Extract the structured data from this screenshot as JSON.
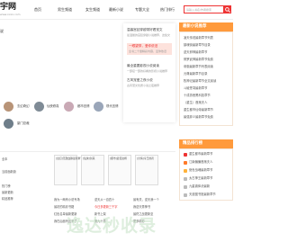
{
  "header": {
    "logo": "宇网",
    "logo_sub": "www.xxxx.com",
    "nav": [
      "首页",
      "男生频道",
      "女生频道",
      "最新小说",
      "专题大全",
      "热门排行"
    ],
    "search_placeholder": "请输入书名/作者搜索"
  },
  "main": {
    "section_label": "说",
    "thumbs_row1": [
      "玄幻奇幻",
      "仙侠修真",
      "都市言情",
      "现代言情",
      "古代言情"
    ],
    "thumbs_row2": [
      "豪门总裁"
    ]
  },
  "dropdown": {
    "items": [
      {
        "title": "温馨宫廷穿越带好看宠文",
        "sub": "最温馨的宫廷穿越小说推荐，这些文"
      },
      {
        "title": "一眼望穿，爱你依旧",
        "sub": "全书二十章精彩内容，爱你依旧"
      },
      {
        "title": "最全重要影视小说阅读",
        "sub": "一部接一部的好看的影视小说推荐"
      },
      {
        "title": "古风宠爱之夜小说",
        "sub": "古风宠文优质小说之夜推荐"
      }
    ]
  },
  "right_panel": {
    "title1": "最新小说推荐",
    "rows1": [
      "凌天传说最新章节列表",
      "镇魂街最新章节目录",
      "逆天邪神最新章节",
      "修罗武神最新章节免费",
      "帝霸最新章节列表阅读",
      "元尊最新章节目录",
      "牧神记最新章节全文阅读",
      "斗破苍穹最新章节",
      "十成熟悉黑科技章节",
      "（重生）首席夫人",
      "重生都市仙帝最新章节",
      "最强弃少最新章节免费"
    ],
    "title2": "精品排行榜",
    "rows2": [
      "重生都市最新章节",
      "江南偏偏首席夫人",
      "绝世战魂最新章节",
      "太古神王最新章节",
      "九星霸体诀最新",
      "天道图书馆最新章节"
    ]
  },
  "bottom": {
    "left_labels": [
      "全本",
      "当前面新篇",
      "",
      "热门榜",
      "最新更新",
      "精品推荐"
    ],
    "cards": [
      {
        "title": "[玄幻]无敌血脉最新章节"
      },
      {
        "title": "[仙侠]剑来"
      },
      {
        "title": "[都市]最佳女婿"
      },
      {
        "title": "[言情]冷王的药"
      }
    ],
    "list_rows": [
      {
        "a": "我为一两有小说专场",
        "b": "逆天从一百四十",
        "c": "最有关，逆天我一个"
      },
      {
        "a": "最初的精彩书籍",
        "b": "今日多更新三千字",
        "c": "我逆天秀神书"
      },
      {
        "a": "红色名单最新更新",
        "b": "新书上架",
        "c": "最终之战更新至"
      },
      {
        "a": "我在后面列出来了",
        "b": "第九十章",
        "c": "更多精彩"
      }
    ]
  },
  "watermark": "逸达秒收录",
  "colors": {
    "accent": "#e33333",
    "orange": "#ff9a3c"
  }
}
